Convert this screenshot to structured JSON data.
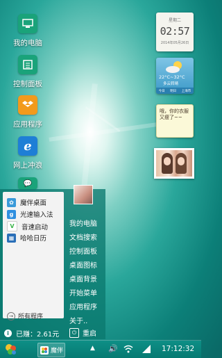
{
  "desktop": {
    "icons": [
      {
        "label": "我的电脑",
        "icon": "computer-icon",
        "color": "#1aa37a"
      },
      {
        "label": "控制面板",
        "icon": "control-panel-icon",
        "color": "#1aa37a"
      },
      {
        "label": "应用程序",
        "icon": "dropbox-icon",
        "color": "#f29a1c"
      },
      {
        "label": "网上冲浪",
        "icon": "ie-browser-icon",
        "color": "#1e7fd6"
      }
    ]
  },
  "widgets": {
    "clock": {
      "day": "星期二",
      "time": "02:57",
      "date": "2014年05月26日"
    },
    "weather": {
      "temp": "22°C~32°C",
      "city": "多云转晴",
      "days": [
        "今日",
        "明日",
        "上海市"
      ]
    },
    "note": {
      "text": "哦，你的衣服又瘦了~~"
    }
  },
  "start_menu": {
    "left_items": [
      {
        "label": "魔伴桌面",
        "icon": "mopan-icon",
        "color": "#3a9ad9"
      },
      {
        "label": "光速输入法",
        "icon": "input-method-icon",
        "color": "#2f8fe0"
      },
      {
        "label": "音速启动",
        "icon": "quick-launch-icon",
        "color": "#3bb54a"
      },
      {
        "label": "哈哈日历",
        "icon": "calendar-icon",
        "color": "#2a6fb8"
      }
    ],
    "all_programs": "所有程序",
    "right_items": [
      "我的电脑",
      "文档搜索",
      "控制面板",
      "桌面图标",
      "桌面背景",
      "开始菜单",
      "应用程序",
      "关于.."
    ],
    "earned": "已赚：2.61元",
    "restart": "重启"
  },
  "taskbar": {
    "task_label": "魔伴",
    "time": "17:12:32"
  }
}
